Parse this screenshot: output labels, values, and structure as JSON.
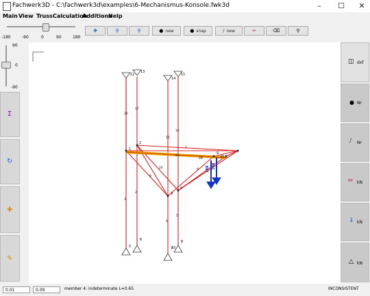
{
  "window": {
    "title": "Fachwerk3D - C:\\fachwerk3d\\examples\\6-Mechanismus-Konsole.fwk3d"
  },
  "menu": [
    "Main",
    "View",
    "Truss",
    "Calculation",
    "Additions",
    "Help"
  ],
  "toolbar": {
    "slider_ticks": [
      "-180",
      "-90",
      "0",
      "90",
      "180"
    ],
    "buttons": [
      {
        "icon": "zoom-fit-icon",
        "label": ""
      },
      {
        "icon": "zoom-in-icon",
        "label": ""
      },
      {
        "icon": "zoom-out-icon",
        "label": ""
      },
      {
        "icon": "new-node-icon",
        "label": "new"
      },
      {
        "icon": "snap-node-icon",
        "label": "snap"
      },
      {
        "icon": "new-member-icon",
        "label": "new"
      },
      {
        "icon": "pen-icon",
        "label": ""
      },
      {
        "icon": "delete-icon",
        "label": ""
      },
      {
        "icon": "view-icon",
        "label": ""
      }
    ]
  },
  "left_panel": {
    "slider_ticks": [
      "90",
      "0",
      "-90"
    ],
    "buttons": [
      "sum-icon",
      "rotate-icon",
      "select-icon",
      "draw-icon"
    ]
  },
  "right_panel": {
    "buttons": [
      {
        "icon": "dxf-icon",
        "label": "dxf"
      },
      {
        "icon": "node-icon",
        "label": "Nr"
      },
      {
        "icon": "member-icon",
        "label": "Nr"
      },
      {
        "icon": "force-icon",
        "label": "kN"
      },
      {
        "icon": "load-icon",
        "label": "kN"
      },
      {
        "icon": "support-icon",
        "label": "kN"
      }
    ]
  },
  "canvas": {
    "node_labels": [
      "13",
      "12",
      "11",
      "14",
      "1",
      "2",
      "3",
      "4",
      "5",
      "6",
      "7",
      "8",
      "9",
      "10",
      "20"
    ],
    "member_labels": [
      "20",
      "17",
      "16",
      "15",
      "24",
      "1",
      "3",
      "2",
      "4",
      "5",
      "8",
      "4",
      "28",
      "23"
    ],
    "loads": [
      "188",
      "188"
    ]
  },
  "status": {
    "field1": "0.01",
    "field2": "0.09",
    "message": "member 4: indeterminate  L=0.65",
    "state": "INCONSISTENT"
  },
  "colors": {
    "member": "#dd2222",
    "highlight": "#f0a000",
    "load": "#1133cc"
  }
}
